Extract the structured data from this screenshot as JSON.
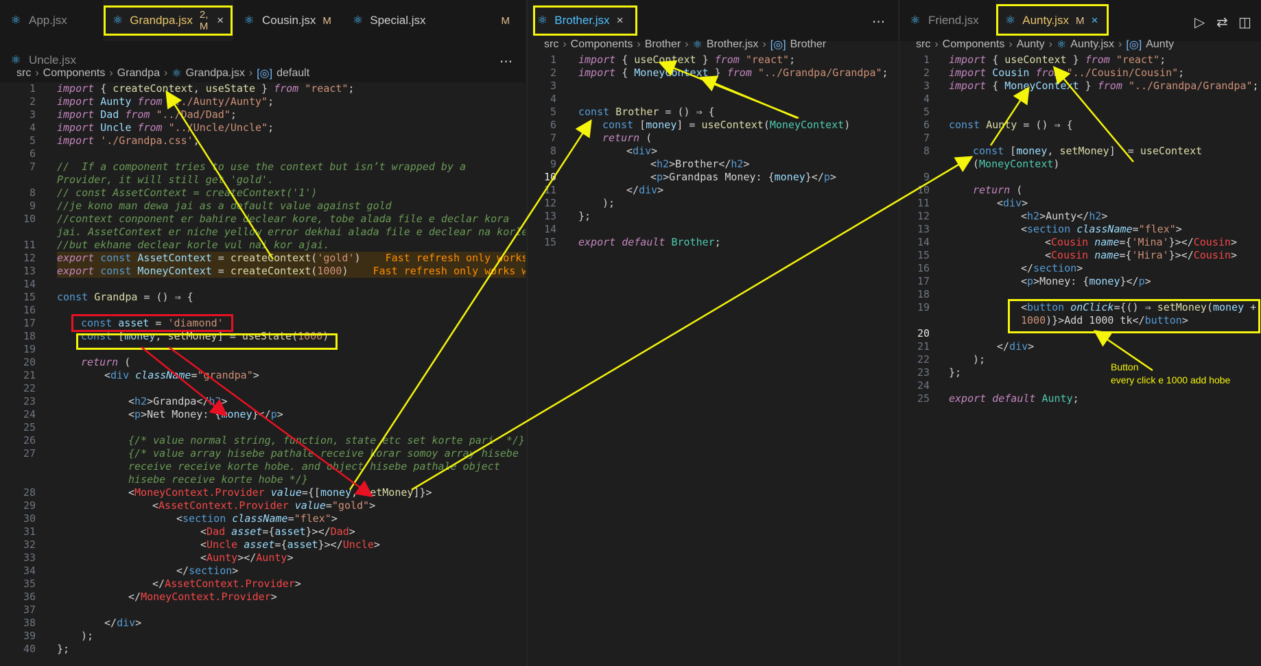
{
  "left": {
    "tabs": [
      {
        "name": "App.jsx",
        "mod": ""
      },
      {
        "name": "Grandpa.jsx",
        "mod": "2, M",
        "close": "×"
      },
      {
        "name": "Cousin.jsx",
        "mod": "M"
      },
      {
        "name": "Special.jsx",
        "mod": "M"
      },
      {
        "name": "Uncle.jsx",
        "mod": ""
      }
    ],
    "more": "···",
    "breadcrumb": [
      "src",
      "Components",
      "Grandpa",
      "Grandpa.jsx",
      "default"
    ]
  },
  "middle": {
    "tab": {
      "name": "Brother.jsx",
      "close": "×"
    },
    "more": "···",
    "breadcrumb": [
      "src",
      "Components",
      "Brother",
      "Brother.jsx",
      "Brother"
    ]
  },
  "right": {
    "tabs": [
      {
        "name": "Friend.jsx",
        "mod": ""
      },
      {
        "name": "Aunty.jsx",
        "mod": "M",
        "close": "×"
      }
    ],
    "breadcrumb": [
      "src",
      "Components",
      "Aunty",
      "Aunty.jsx",
      "Aunty"
    ]
  },
  "annotation": {
    "line1": "Button",
    "line2": "every click e 1000 add hobe"
  },
  "colors": {
    "highlight": "#f4f40c",
    "danger": "#e81123"
  }
}
